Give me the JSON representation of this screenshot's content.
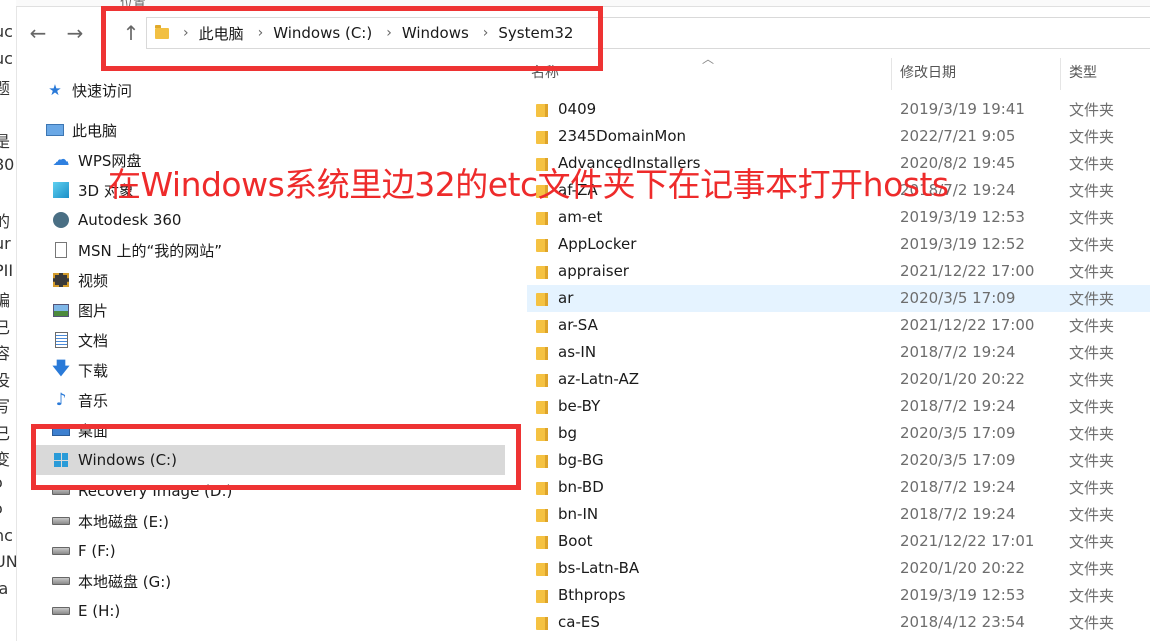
{
  "left_edge_fragments": [
    "uc",
    "uc",
    "题",
    "、",
    "是",
    "80",
    "、",
    "的",
    "ur",
    "PII",
    "编",
    "已",
    "容",
    "没",
    "写",
    "已",
    "变",
    "ɔ",
    "ɔ",
    "nc",
    "UN",
    "ja"
  ],
  "header_fragments": [
    "位置",
    "名称"
  ],
  "nav": {
    "back_label": "←",
    "forward_label": "→",
    "up_label": "↑"
  },
  "breadcrumb": [
    "此电脑",
    "Windows (C:)",
    "Windows",
    "System32"
  ],
  "overlay_caption": "在Windows系统里边32的etc文件夹下在记事本打开hosts",
  "sidebar": {
    "items": [
      {
        "label": "快速访问",
        "icon": "star-icon"
      },
      {
        "label": "此电脑",
        "icon": "computer-icon"
      },
      {
        "label": "WPS网盘",
        "icon": "cloud-icon"
      },
      {
        "label": "3D 对象",
        "icon": "cube-icon"
      },
      {
        "label": "Autodesk 360",
        "icon": "autodesk-icon"
      },
      {
        "label": "MSN 上的“我的网站”",
        "icon": "document-icon"
      },
      {
        "label": "视频",
        "icon": "video-icon"
      },
      {
        "label": "图片",
        "icon": "picture-icon"
      },
      {
        "label": "文档",
        "icon": "documents-icon"
      },
      {
        "label": "下载",
        "icon": "download-icon"
      },
      {
        "label": "音乐",
        "icon": "music-icon"
      },
      {
        "label": "桌面",
        "icon": "desktop-icon"
      },
      {
        "label": "Windows (C:)",
        "icon": "windows-drive-icon",
        "selected": true
      },
      {
        "label": "Recovery Image (D:)",
        "icon": "drive-icon"
      },
      {
        "label": "本地磁盘 (E:)",
        "icon": "drive-icon"
      },
      {
        "label": "F (F:)",
        "icon": "drive-icon"
      },
      {
        "label": "本地磁盘 (G:)",
        "icon": "drive-icon"
      },
      {
        "label": "E (H:)",
        "icon": "drive-icon"
      }
    ]
  },
  "columns": {
    "name": "名称",
    "date": "修改日期",
    "type": "类型"
  },
  "files": [
    {
      "name": "0409",
      "date": "2019/3/19 19:41",
      "type": "文件夹"
    },
    {
      "name": "2345DomainMon",
      "date": "2022/7/21 9:05",
      "type": "文件夹"
    },
    {
      "name": "AdvancedInstallers",
      "date": "2020/8/2 19:45",
      "type": "文件夹"
    },
    {
      "name": "af-ZA",
      "date": "2018/7/2 19:24",
      "type": "文件夹"
    },
    {
      "name": "am-et",
      "date": "2019/3/19 12:53",
      "type": "文件夹"
    },
    {
      "name": "AppLocker",
      "date": "2019/3/19 12:52",
      "type": "文件夹"
    },
    {
      "name": "appraiser",
      "date": "2021/12/22 17:00",
      "type": "文件夹"
    },
    {
      "name": "ar",
      "date": "2020/3/5 17:09",
      "type": "文件夹",
      "hover": true
    },
    {
      "name": "ar-SA",
      "date": "2021/12/22 17:00",
      "type": "文件夹"
    },
    {
      "name": "as-IN",
      "date": "2018/7/2 19:24",
      "type": "文件夹"
    },
    {
      "name": "az-Latn-AZ",
      "date": "2020/1/20 20:22",
      "type": "文件夹"
    },
    {
      "name": "be-BY",
      "date": "2018/7/2 19:24",
      "type": "文件夹"
    },
    {
      "name": "bg",
      "date": "2020/3/5 17:09",
      "type": "文件夹"
    },
    {
      "name": "bg-BG",
      "date": "2020/3/5 17:09",
      "type": "文件夹"
    },
    {
      "name": "bn-BD",
      "date": "2018/7/2 19:24",
      "type": "文件夹"
    },
    {
      "name": "bn-IN",
      "date": "2018/7/2 19:24",
      "type": "文件夹"
    },
    {
      "name": "Boot",
      "date": "2021/12/22 17:01",
      "type": "文件夹"
    },
    {
      "name": "bs-Latn-BA",
      "date": "2020/1/20 20:22",
      "type": "文件夹"
    },
    {
      "name": "Bthprops",
      "date": "2019/3/19 12:53",
      "type": "文件夹"
    },
    {
      "name": "ca-ES",
      "date": "2018/4/12 23:54",
      "type": "文件夹"
    }
  ],
  "colors": {
    "highlight": "#ee3333",
    "selected_bg": "#d9d9d9",
    "hover_bg": "#e5f3ff",
    "folder": "#f5c242"
  }
}
